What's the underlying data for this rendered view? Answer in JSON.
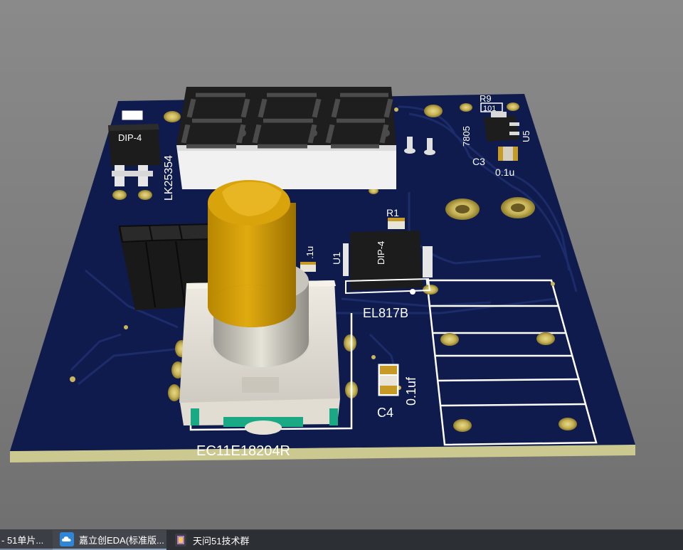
{
  "viewer": {
    "background": "#7f7f7f",
    "board_color": "#0e1a4a",
    "board_edge_color": "#cfcf96",
    "silkscreen_color": "#ffffff",
    "pad_color": "#c8b45a"
  },
  "pcb": {
    "display": {
      "segments": "8.8.8."
    },
    "labels": {
      "dip4_left": "DIP-4",
      "lk_part": "LK25354",
      "r9": "R9",
      "r9_value": "101",
      "reg_7805": "7805",
      "u5": "U5",
      "c3": "C3",
      "c3_value": "0.1u",
      "r1": "R1",
      "dip4_right": "DIP-4",
      "u1": "U1",
      "cap_small": ".1u",
      "el817b": "EL817B",
      "c4_value": "0.1uf",
      "c4": "C4",
      "encoder": "EC11E18204R"
    }
  },
  "taskbar": {
    "items": [
      {
        "label": "- 51单片...",
        "icon": "app-icon"
      },
      {
        "label": "嘉立创EDA(标准版...",
        "icon": "cloud-icon"
      },
      {
        "label": "天问51技术群",
        "icon": "chat-icon"
      }
    ]
  }
}
